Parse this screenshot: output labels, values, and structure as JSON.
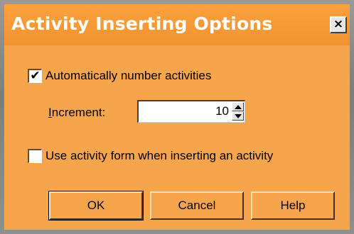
{
  "dialog": {
    "title": "Activity Inserting Options",
    "close_label": "×"
  },
  "options": {
    "auto_number": {
      "checked_mark": "✔",
      "label": "Automatically number activities"
    },
    "increment": {
      "label_first": "I",
      "label_rest": "ncrement:",
      "value": "10"
    },
    "use_form": {
      "checked_mark": "",
      "label": "Use activity form when inserting an activity"
    }
  },
  "buttons": {
    "ok": "OK",
    "cancel": "Cancel",
    "help": "Help"
  },
  "colors": {
    "dialog_bg": "#f7a54a",
    "title_text": "#ffffff"
  }
}
